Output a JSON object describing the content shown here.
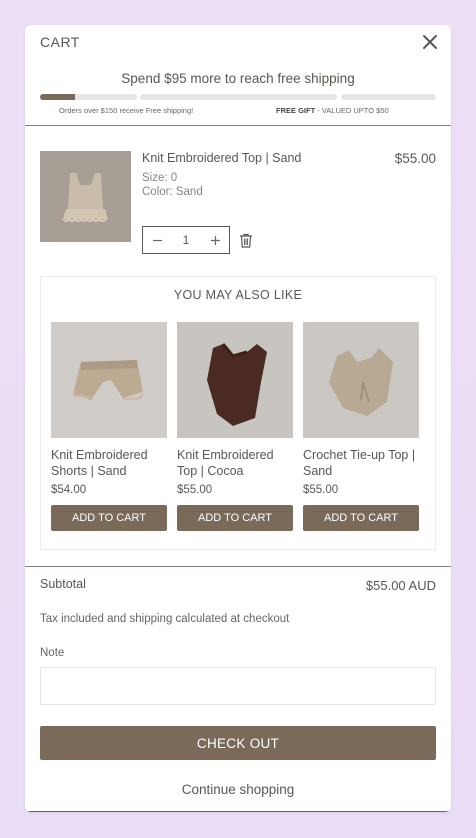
{
  "header": {
    "title": "CART"
  },
  "shipping": {
    "message": "Spend $95 more to reach free shipping",
    "progress_segment1": 0.36,
    "progress_segment2": 0,
    "progress_segment3": 0,
    "label_left": "Orders over $150 receive Free shipping!",
    "label_right_bold": "FREE GIFT",
    "label_right_rest": " - VALUED UPTO $50"
  },
  "item": {
    "title": "Knit Embroidered Top | Sand",
    "price": "$55.00",
    "size": "Size:  0",
    "color": "Color:  Sand",
    "quantity": "1"
  },
  "recommendations": {
    "title": "YOU MAY ALSO LIKE",
    "items": [
      {
        "name": "Knit Embroidered Shorts | Sand",
        "price": "$54.00",
        "button": "ADD TO CART"
      },
      {
        "name": "Knit Embroidered Top | Cocoa",
        "price": "$55.00",
        "button": "ADD TO CART"
      },
      {
        "name": "Crochet Tie-up Top | Sand",
        "price": "$55.00",
        "button": "ADD TO CART"
      }
    ]
  },
  "footer": {
    "subtotal_label": "Subtotal",
    "subtotal_value": "$55.00 AUD",
    "tax_note": "Tax included and shipping calculated at checkout",
    "note_label": "Note",
    "note_value": "",
    "checkout_label": "CHECK OUT",
    "continue_label": "Continue shopping"
  },
  "colors": {
    "accent": "#7a6a5a",
    "text": "#5b5651"
  }
}
